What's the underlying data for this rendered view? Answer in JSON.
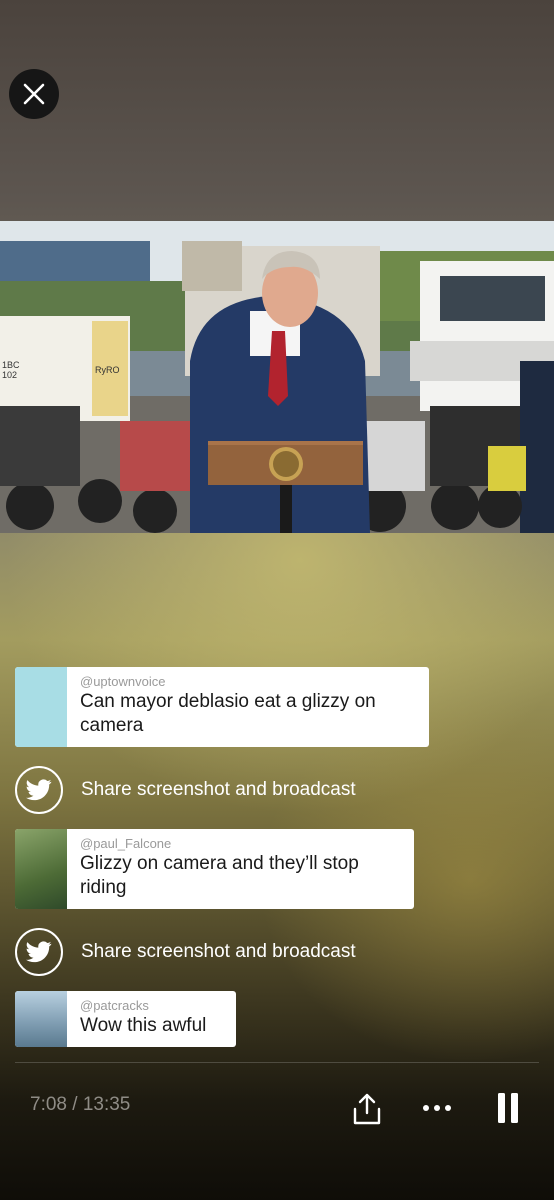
{
  "player": {
    "close_icon": "close-icon",
    "time_display": "7:08 / 13:35",
    "share_icon": "share-icon",
    "more_icon": "more-options-icon",
    "pause_icon": "pause-icon"
  },
  "video": {
    "description_icon": "broadcast-video",
    "sign_texts": [
      "1BC",
      "102",
      "RyRO"
    ]
  },
  "chat": {
    "items": [
      {
        "type": "comment",
        "user": "@uptownvoice",
        "text": "Can mayor deblasio eat a glizzy on camera",
        "avatar_color": "#a8dde5"
      },
      {
        "type": "share",
        "label": "Share screenshot and broadcast",
        "icon": "twitter-bird-icon"
      },
      {
        "type": "comment",
        "user": "@paul_Falcone",
        "text": "Glizzy on camera and they’ll stop riding",
        "avatar_color": "#6d8a4c"
      },
      {
        "type": "share",
        "label": "Share screenshot and broadcast",
        "icon": "twitter-bird-icon"
      },
      {
        "type": "comment",
        "user": "@patcracks",
        "text": "Wow this awful",
        "avatar_color": "#7d9bb0"
      }
    ]
  }
}
